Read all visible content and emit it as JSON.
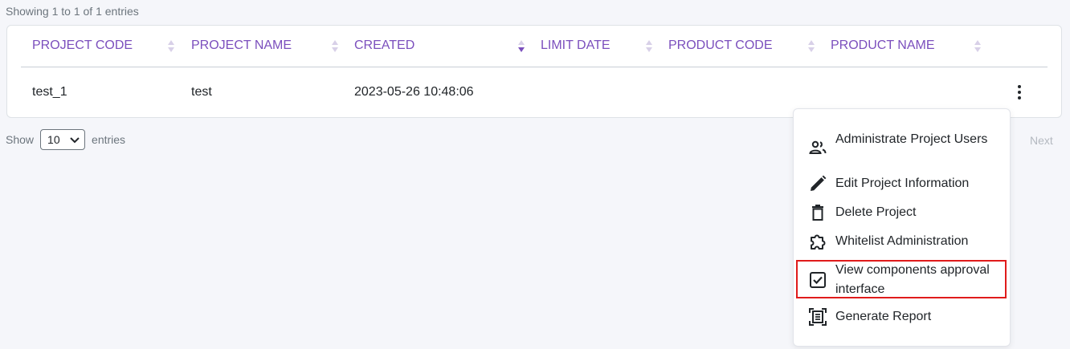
{
  "info_top": "Showing 1 to 1 of 1 entries",
  "table": {
    "headers": [
      "PROJECT CODE",
      "PROJECT NAME",
      "CREATED",
      "LIMIT DATE",
      "PRODUCT CODE",
      "PRODUCT NAME"
    ],
    "sorted_column": "CREATED",
    "rows": [
      {
        "project_code": "test_1",
        "project_name": "test",
        "created": "2023-05-26 10:48:06",
        "limit_date": "",
        "product_code": "",
        "product_name": ""
      }
    ]
  },
  "length": {
    "show": "Show",
    "value": "10",
    "entries": "entries"
  },
  "pagination": {
    "next": "Next"
  },
  "menu": {
    "items": [
      {
        "label": "Administrate Project Users",
        "icon": "users-icon"
      },
      {
        "label": "Edit Project Information",
        "icon": "pencil-icon"
      },
      {
        "label": "Delete Project",
        "icon": "trash-icon"
      },
      {
        "label": "Whitelist Administration",
        "icon": "puzzle-icon"
      },
      {
        "label": "View components approval interface",
        "icon": "checkbox-icon"
      },
      {
        "label": "Generate Report",
        "icon": "report-icon"
      }
    ]
  },
  "colors": {
    "accent": "#7b4fbd",
    "highlight": "#e01b1b"
  }
}
